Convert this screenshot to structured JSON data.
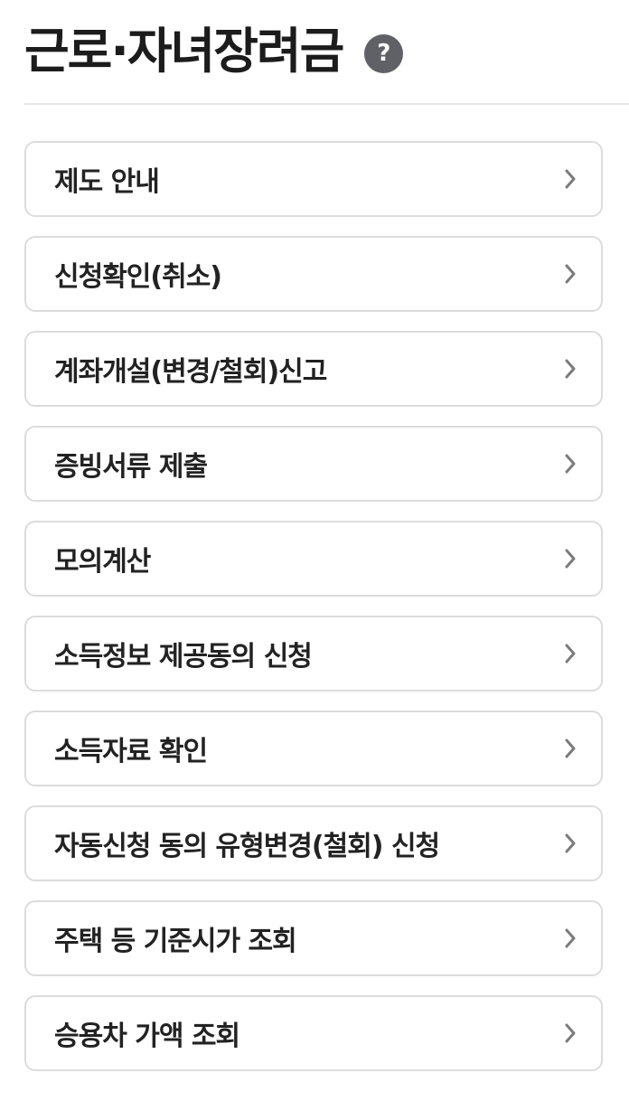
{
  "header": {
    "title": "근로·자녀장려금",
    "help_icon": "help-question-icon",
    "help_label": "?"
  },
  "menu": {
    "items": [
      {
        "label": "제도 안내"
      },
      {
        "label": "신청확인(취소)"
      },
      {
        "label": "계좌개설(변경/철회)신고"
      },
      {
        "label": "증빙서류 제출"
      },
      {
        "label": "모의계산"
      },
      {
        "label": "소득정보 제공동의 신청"
      },
      {
        "label": "소득자료 확인"
      },
      {
        "label": "자동신청 동의 유형변경(철회) 신청"
      },
      {
        "label": "주택 등 기준시가 조회"
      },
      {
        "label": "승용차 가액 조회"
      }
    ],
    "chevron_icon": "chevron-right-icon"
  },
  "colors": {
    "border": "#dcdcdc",
    "text": "#222222",
    "help_icon_bg": "#5f6166",
    "chevron": "#7b7b7b"
  }
}
